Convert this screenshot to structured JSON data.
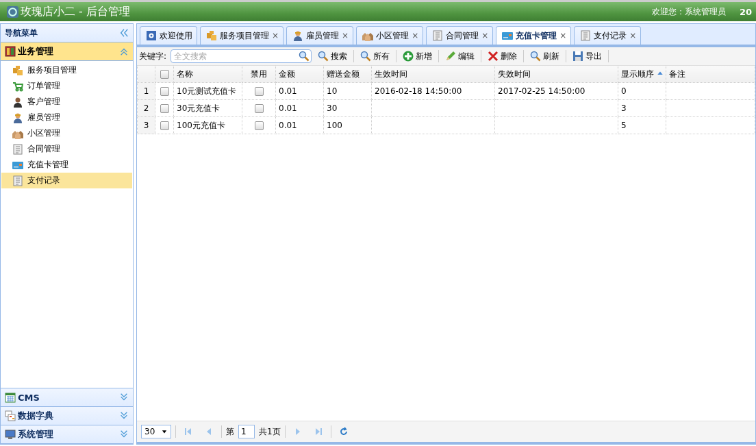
{
  "header": {
    "title": "玫瑰店小二 - 后台管理",
    "welcome": "欢迎您：系统管理员",
    "extra": "20"
  },
  "sidebar": {
    "title": "导航菜单",
    "panels": [
      {
        "title": "业务管理",
        "expanded": true,
        "items": [
          {
            "label": "服务项目管理",
            "selected": false
          },
          {
            "label": "订单管理",
            "selected": false
          },
          {
            "label": "客户管理",
            "selected": false
          },
          {
            "label": "雇员管理",
            "selected": false
          },
          {
            "label": "小区管理",
            "selected": false
          },
          {
            "label": "合同管理",
            "selected": false
          },
          {
            "label": "充值卡管理",
            "selected": false
          },
          {
            "label": "支付记录",
            "selected": true
          }
        ]
      },
      {
        "title": "CMS",
        "expanded": false
      },
      {
        "title": "数据字典",
        "expanded": false
      },
      {
        "title": "系统管理",
        "expanded": false
      }
    ]
  },
  "tabs": [
    {
      "label": "欢迎使用",
      "selected": false
    },
    {
      "label": "服务项目管理",
      "selected": false,
      "close": "×"
    },
    {
      "label": "雇员管理",
      "selected": false,
      "close": "×"
    },
    {
      "label": "小区管理",
      "selected": false,
      "close": "×"
    },
    {
      "label": "合同管理",
      "selected": false,
      "close": "×"
    },
    {
      "label": "充值卡管理",
      "selected": true,
      "close": "×"
    },
    {
      "label": "支付记录",
      "selected": false,
      "close": "×"
    }
  ],
  "toolbar": {
    "keyword_label": "关键字:",
    "search": {
      "placeholder": "全文搜索"
    },
    "buttons": [
      "搜索",
      "所有",
      "新增",
      "编辑",
      "删除",
      "刷新",
      "导出"
    ]
  },
  "table": {
    "header_checked": false,
    "columns": [
      {
        "label": "名称",
        "sorted": false
      },
      {
        "label": "禁用",
        "sorted": false
      },
      {
        "label": "金额",
        "sorted": false
      },
      {
        "label": "赠送金额",
        "sorted": false
      },
      {
        "label": "生效时间",
        "sorted": false
      },
      {
        "label": "失效时间",
        "sorted": false
      },
      {
        "label": "显示顺序",
        "sorted": true
      },
      {
        "label": "备注",
        "sorted": false
      }
    ],
    "rows": [
      {
        "index": "1",
        "checked": false,
        "name": "10元测试充值卡",
        "disabled": false,
        "amount": "0.01",
        "bonus": "10",
        "start": "2016-02-18 14:50:00",
        "end": "2017-02-25 14:50:00",
        "order": "0",
        "note": ""
      },
      {
        "index": "2",
        "checked": false,
        "name": "30元充值卡",
        "disabled": false,
        "amount": "0.01",
        "bonus": "30",
        "start": "",
        "end": "",
        "order": "3",
        "note": ""
      },
      {
        "index": "3",
        "checked": false,
        "name": "100元充值卡",
        "disabled": false,
        "amount": "0.01",
        "bonus": "100",
        "start": "",
        "end": "",
        "order": "5",
        "note": ""
      }
    ]
  },
  "pager": {
    "page_size": "30",
    "page_prefix": "第",
    "page": "1",
    "page_suffix": "共1页"
  }
}
